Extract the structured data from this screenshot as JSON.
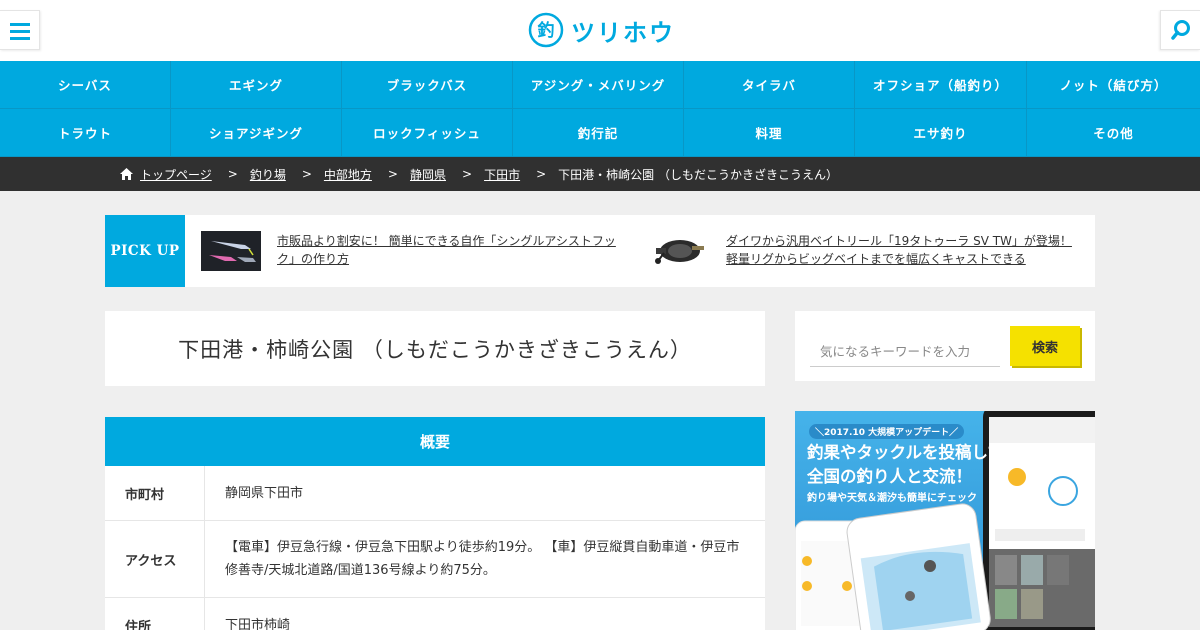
{
  "header": {
    "logo_text": "ツリホウ",
    "logo_glyph": "釣",
    "menu_icon": "menu-icon",
    "search_icon": "search-icon"
  },
  "nav": {
    "items": [
      "シーバス",
      "エギング",
      "ブラックバス",
      "アジング・メバリング",
      "タイラバ",
      "オフショア（船釣り）",
      "ノット（結び方）",
      "トラウト",
      "ショアジギング",
      "ロックフィッシュ",
      "釣行記",
      "料理",
      "エサ釣り",
      "その他"
    ]
  },
  "breadcrumb": {
    "home": "トップページ",
    "items": [
      "釣り場",
      "中部地方",
      "静岡県",
      "下田市"
    ],
    "current": "下田港・柿崎公園 （しもだこうかきざきこうえん）",
    "separator": ">"
  },
  "pickup": {
    "label": "PICK UP",
    "articles": [
      {
        "text": "市販品より割安に！ 簡単にできる自作「シングルアシストフック」の作り方"
      },
      {
        "text": "ダイワから汎用ベイトリール「19タトゥーラ SV TW」が登場！軽量リグからビッグベイトまでを幅広くキャストできる"
      }
    ]
  },
  "page": {
    "title": "下田港・柿崎公園 （しもだこうかきざきこうえん）"
  },
  "search": {
    "placeholder": "気になるキーワードを入力",
    "button": "検索"
  },
  "overview": {
    "heading": "概要",
    "rows": [
      {
        "key": "市町村",
        "value": "静岡県下田市"
      },
      {
        "key": "アクセス",
        "value": "【電車】伊豆急行線・伊豆急下田駅より徒歩約19分。 【車】伊豆縦貫自動車道・伊豆市 修善寺/天城北道路/国道136号線より約75分。"
      },
      {
        "key": "住所",
        "value": "下田市柿崎"
      }
    ]
  },
  "banner": {
    "top": "＼2017.10 大規模アップデート／",
    "headline": "釣果やタックルを投稿して全国の釣り人と交流！",
    "sub": "釣り場や天気＆潮汐も簡単にチェック"
  },
  "colors": {
    "accent": "#00a9df",
    "breadcrumb_bg": "#303030",
    "search_button": "#f5e100"
  }
}
